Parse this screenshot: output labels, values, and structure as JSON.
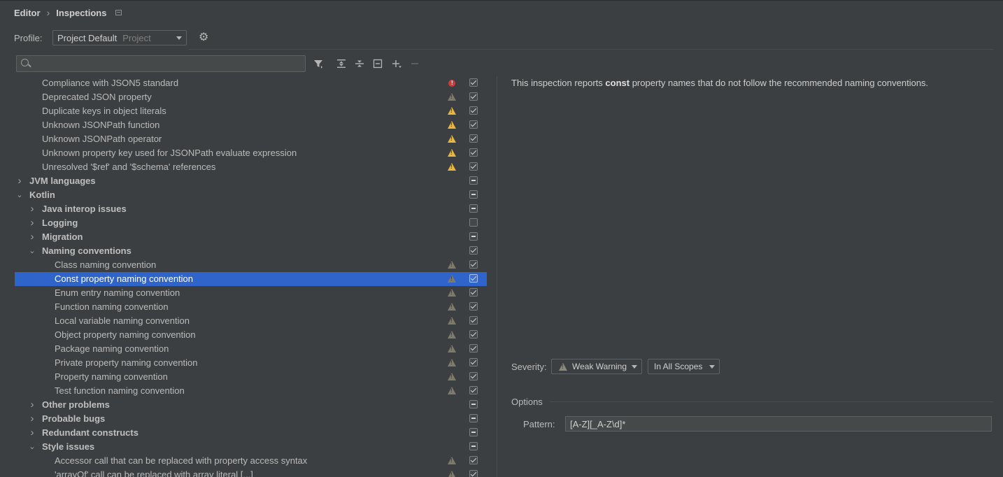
{
  "breadcrumb": {
    "parent": "Editor",
    "current": "Inspections"
  },
  "profile": {
    "label": "Profile:",
    "value": "Project Default",
    "scope": "Project"
  },
  "search": {
    "value": "",
    "placeholder": ""
  },
  "toolbar": {
    "icons": [
      "filter-icon",
      "expand-all-icon",
      "collapse-all-icon",
      "reset-icon",
      "add-icon",
      "remove-icon"
    ]
  },
  "tree": {
    "rows": [
      {
        "label": "Compliance with JSON5 standard",
        "indent": 2,
        "bold": false,
        "arrow": "",
        "sev": "error",
        "check": "checked"
      },
      {
        "label": "Deprecated JSON property",
        "indent": 2,
        "bold": false,
        "arrow": "",
        "sev": "weak",
        "check": "checked"
      },
      {
        "label": "Duplicate keys in object literals",
        "indent": 2,
        "bold": false,
        "arrow": "",
        "sev": "warn",
        "check": "checked"
      },
      {
        "label": "Unknown JSONPath function",
        "indent": 2,
        "bold": false,
        "arrow": "",
        "sev": "warn",
        "check": "checked"
      },
      {
        "label": "Unknown JSONPath operator",
        "indent": 2,
        "bold": false,
        "arrow": "",
        "sev": "warn",
        "check": "checked"
      },
      {
        "label": "Unknown property key used for JSONPath evaluate expression",
        "indent": 2,
        "bold": false,
        "arrow": "",
        "sev": "warn",
        "check": "checked"
      },
      {
        "label": "Unresolved '$ref' and '$schema' references",
        "indent": 2,
        "bold": false,
        "arrow": "",
        "sev": "warn",
        "check": "checked"
      },
      {
        "label": "JVM languages",
        "indent": 1,
        "bold": true,
        "arrow": "collapsed",
        "sev": "",
        "check": "mixed"
      },
      {
        "label": "Kotlin",
        "indent": 1,
        "bold": true,
        "arrow": "expanded",
        "sev": "",
        "check": "mixed"
      },
      {
        "label": "Java interop issues",
        "indent": 2,
        "bold": true,
        "arrow": "collapsed",
        "sev": "",
        "check": "mixed"
      },
      {
        "label": "Logging",
        "indent": 2,
        "bold": true,
        "arrow": "collapsed",
        "sev": "",
        "check": "unchecked"
      },
      {
        "label": "Migration",
        "indent": 2,
        "bold": true,
        "arrow": "collapsed",
        "sev": "",
        "check": "mixed"
      },
      {
        "label": "Naming conventions",
        "indent": 2,
        "bold": true,
        "arrow": "expanded",
        "sev": "",
        "check": "checked"
      },
      {
        "label": "Class naming convention",
        "indent": 3,
        "bold": false,
        "arrow": "",
        "sev": "weak",
        "check": "checked"
      },
      {
        "label": "Const property naming convention",
        "indent": 3,
        "bold": false,
        "arrow": "",
        "sev": "weak",
        "check": "checked",
        "selected": true
      },
      {
        "label": "Enum entry naming convention",
        "indent": 3,
        "bold": false,
        "arrow": "",
        "sev": "weak",
        "check": "checked"
      },
      {
        "label": "Function naming convention",
        "indent": 3,
        "bold": false,
        "arrow": "",
        "sev": "weak",
        "check": "checked"
      },
      {
        "label": "Local variable naming convention",
        "indent": 3,
        "bold": false,
        "arrow": "",
        "sev": "weak",
        "check": "checked"
      },
      {
        "label": "Object property naming convention",
        "indent": 3,
        "bold": false,
        "arrow": "",
        "sev": "weak",
        "check": "checked"
      },
      {
        "label": "Package naming convention",
        "indent": 3,
        "bold": false,
        "arrow": "",
        "sev": "weak",
        "check": "checked"
      },
      {
        "label": "Private property naming convention",
        "indent": 3,
        "bold": false,
        "arrow": "",
        "sev": "weak",
        "check": "checked"
      },
      {
        "label": "Property naming convention",
        "indent": 3,
        "bold": false,
        "arrow": "",
        "sev": "weak",
        "check": "checked"
      },
      {
        "label": "Test function naming convention",
        "indent": 3,
        "bold": false,
        "arrow": "",
        "sev": "weak",
        "check": "checked"
      },
      {
        "label": "Other problems",
        "indent": 2,
        "bold": true,
        "arrow": "collapsed",
        "sev": "",
        "check": "mixed"
      },
      {
        "label": "Probable bugs",
        "indent": 2,
        "bold": true,
        "arrow": "collapsed",
        "sev": "",
        "check": "mixed"
      },
      {
        "label": "Redundant constructs",
        "indent": 2,
        "bold": true,
        "arrow": "collapsed",
        "sev": "",
        "check": "mixed"
      },
      {
        "label": "Style issues",
        "indent": 2,
        "bold": true,
        "arrow": "expanded",
        "sev": "",
        "check": "mixed"
      },
      {
        "label": "Accessor call that can be replaced with property access syntax",
        "indent": 3,
        "bold": false,
        "arrow": "",
        "sev": "weak",
        "check": "checked"
      },
      {
        "label": "'arrayOf' call can be replaced with array literal [...]",
        "indent": 3,
        "bold": false,
        "arrow": "",
        "sev": "weak",
        "check": "checked"
      }
    ]
  },
  "description": {
    "prefix": "This inspection reports ",
    "keyword": "const",
    "suffix": " property names that do not follow the recommended naming conventions."
  },
  "severity": {
    "label": "Severity:",
    "value": "Weak Warning",
    "scope": "In All Scopes"
  },
  "options": {
    "label": "Options",
    "pattern_label": "Pattern:",
    "pattern_value": "[A-Z][_A-Z\\d]*"
  }
}
